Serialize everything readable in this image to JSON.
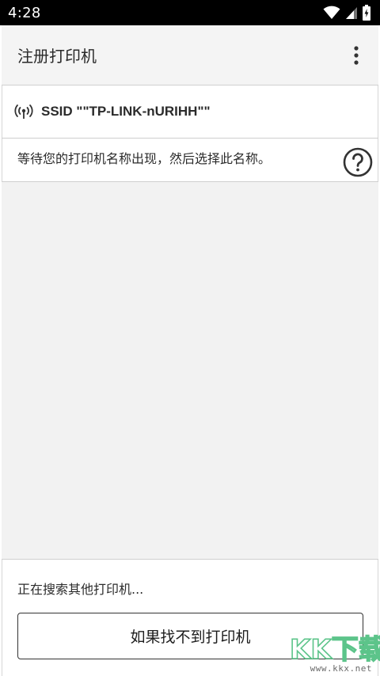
{
  "status_bar": {
    "time": "4:28",
    "icons": [
      "wifi-icon",
      "cellular-signal-icon",
      "battery-charging-icon"
    ]
  },
  "app_bar": {
    "title": "注册打印机",
    "overflow_icon": "more-vert-icon"
  },
  "ssid": {
    "icon": "wireless-antenna-icon",
    "label": "SSID \"\"TP-LINK-nURIHH\"\""
  },
  "instruction": {
    "text": "等待您的打印机名称出现，然后选择此名称。",
    "help_icon": "help-circle-icon"
  },
  "printer_list": {
    "items": []
  },
  "footer": {
    "searching_text": "正在搜索其他打印机...",
    "not_found_button": "如果找不到打印机"
  },
  "watermark": {
    "logo_text": "KK下载",
    "url": "www.kkx.net"
  },
  "colors": {
    "status_bar_bg": "#000000",
    "app_bar_bg": "#f4f4f4",
    "list_bg": "#f2f2f2",
    "divider": "#cfcfcf",
    "text": "#2b2b2b",
    "watermark_green": "#5cc48a"
  }
}
